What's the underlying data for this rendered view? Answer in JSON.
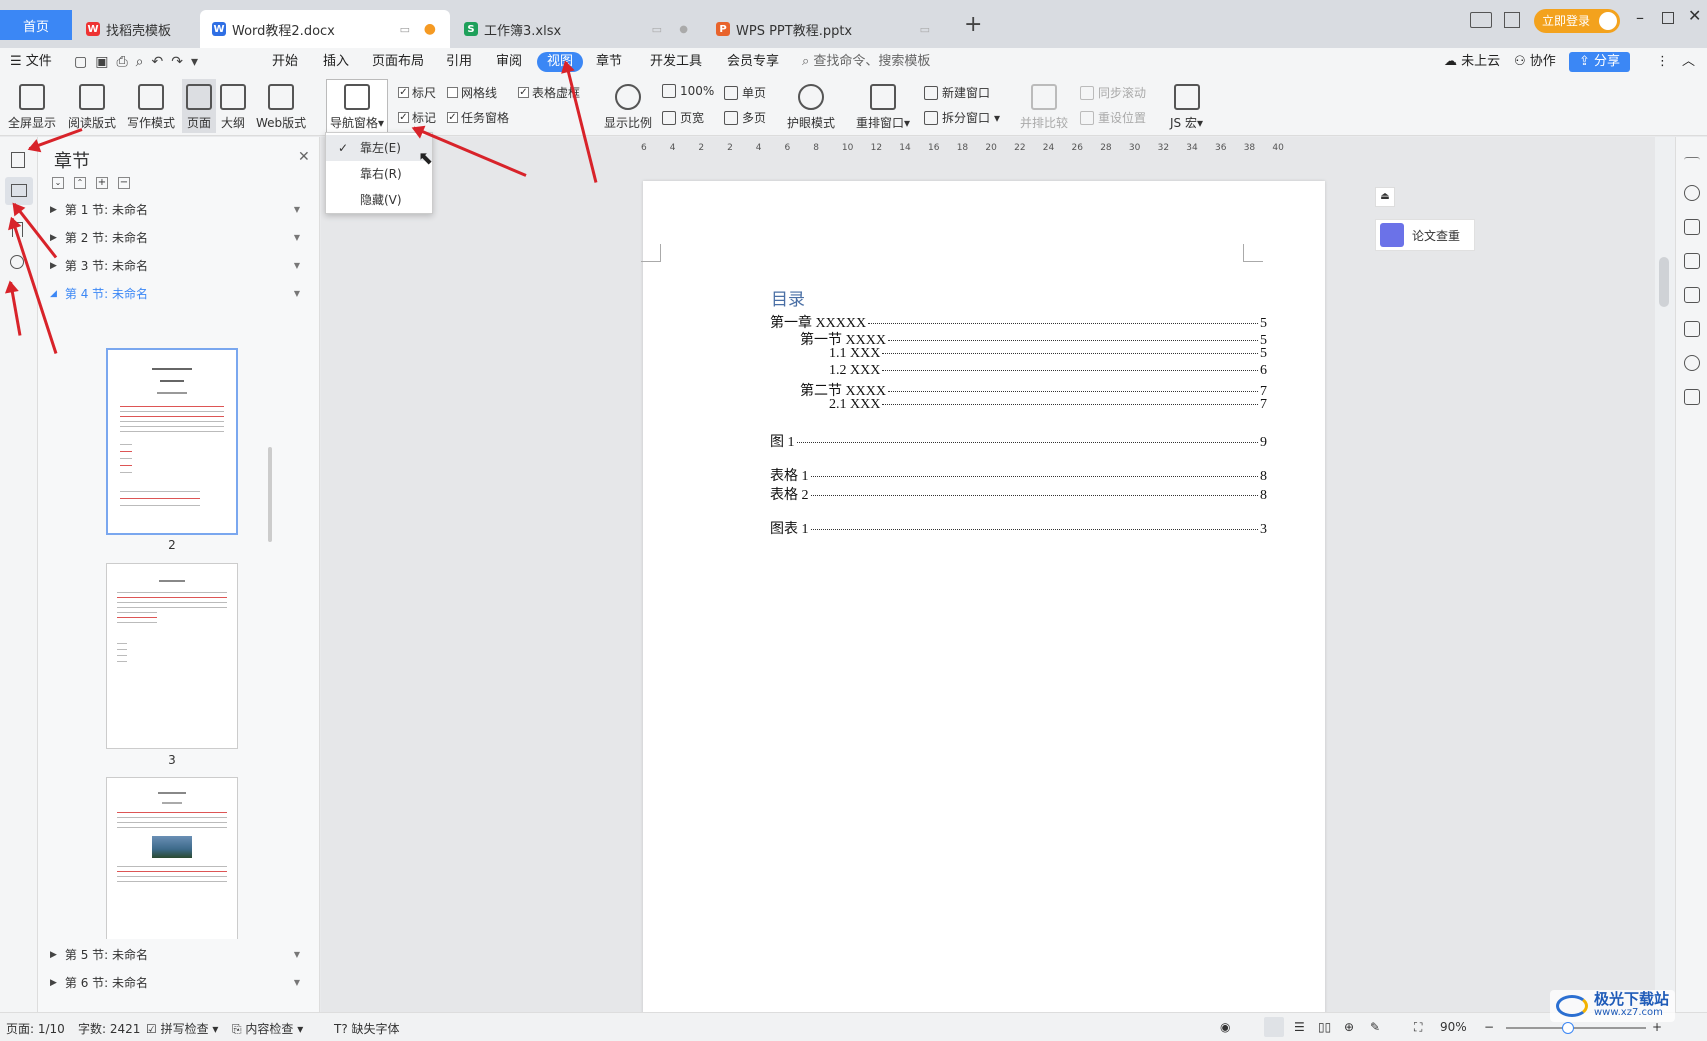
{
  "tabs": {
    "home": "首页",
    "t1": "找稻壳模板",
    "t2": "Word教程2.docx",
    "t3": "工作簿3.xlsx",
    "t4": "WPS PPT教程.pptx",
    "new": "+"
  },
  "topright": {
    "login": "立即登录"
  },
  "menu": {
    "file": "文件",
    "items": [
      "开始",
      "插入",
      "页面布局",
      "引用",
      "审阅",
      "视图",
      "章节",
      "开发工具",
      "会员专享"
    ],
    "search": "查找命令、搜索模板",
    "cloud": "未上云",
    "collab": "协作",
    "share": "分享"
  },
  "ribbon": {
    "fullscreen": "全屏显示",
    "reading": "阅读版式",
    "writing": "写作模式",
    "page": "页面",
    "outline": "大纲",
    "web": "Web版式",
    "navpane": "导航窗格",
    "ruler": "标尺",
    "gridlines": "网格线",
    "tableframe": "表格虚框",
    "mark": "标记",
    "taskpane": "任务窗格",
    "zoomratio": "显示比例",
    "pct100": "100%",
    "singlepage": "单页",
    "pagewidth": "页宽",
    "multipage": "多页",
    "eyecare": "护眼模式",
    "arrange": "重排窗口",
    "newwindow": "新建窗口",
    "splitwindow": "拆分窗口",
    "sidebyside": "并排比较",
    "syncscroll": "同步滚动",
    "resetpos": "重设位置",
    "jsmacro": "JS 宏"
  },
  "dropdown": {
    "left": "靠左(E)",
    "right": "靠右(R)",
    "hide": "隐藏(V)"
  },
  "nav": {
    "title": "章节",
    "sections": [
      "第 1 节: 未命名",
      "第 2 节: 未命名",
      "第 3 节: 未命名",
      "第 4 节: 未命名",
      "第 5 节: 未命名",
      "第 6 节: 未命名"
    ],
    "thumbs": [
      "2",
      "3"
    ]
  },
  "ruler": [
    "6",
    "4",
    "2",
    "2",
    "4",
    "6",
    "8",
    "10",
    "12",
    "14",
    "16",
    "18",
    "20",
    "22",
    "24",
    "26",
    "28",
    "30",
    "32",
    "34",
    "36",
    "38",
    "40"
  ],
  "doc": {
    "toc_title": "目录",
    "entries": [
      {
        "label": "第一章  XXXXX",
        "page": "5"
      },
      {
        "label": "第一节  XXXX",
        "page": "5"
      },
      {
        "label": "1.1 XXX",
        "page": "5"
      },
      {
        "label": "1.2 XXX",
        "page": "6"
      },
      {
        "label": "第二节  XXXX",
        "page": "7"
      },
      {
        "label": "2.1 XXX",
        "page": "7"
      },
      {
        "label": "图  1",
        "page": "9"
      },
      {
        "label": "表格  1",
        "page": "8"
      },
      {
        "label": "表格  2",
        "page": "8"
      },
      {
        "label": "图表  1",
        "page": "3"
      }
    ]
  },
  "sidepanel": {
    "paper": "论文查重"
  },
  "status": {
    "page": "页面: 1/10",
    "words": "字数: 2421",
    "spell": "拼写检查",
    "content": "内容检查",
    "font": "缺失字体",
    "zoom": "90%"
  },
  "watermark": {
    "text": "极光下载站",
    "url": "www.xz7.com"
  }
}
